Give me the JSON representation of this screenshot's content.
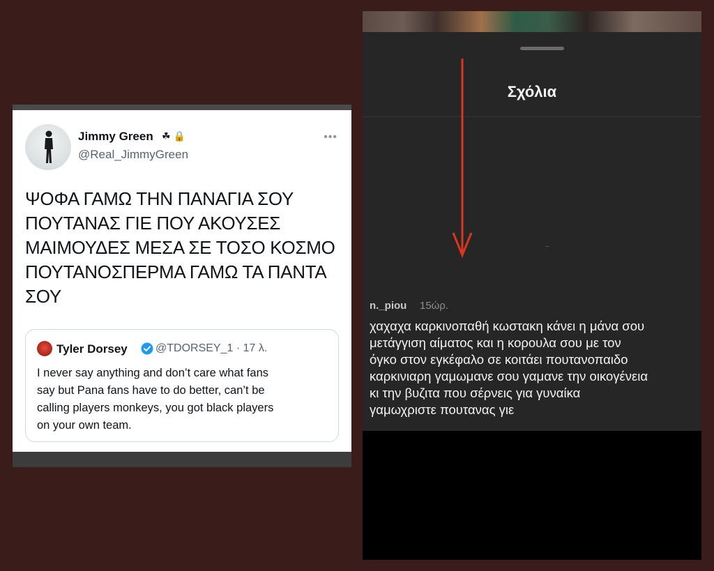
{
  "tweet": {
    "author_name": "Jimmy Green",
    "author_badges": "☘ 🔒",
    "author_handle": "@Real_JimmyGreen",
    "text_lines": [
      "ΨΟΦΑ ΓΑΜΩ ΤΗΝ ΠΑΝΑΓΙΑ ΣΟΥ",
      "ΠΟΥΤΑΝΑΣ ΓΙΕ ΠΟΥ ΑΚΟΥΣΕΣ",
      "ΜΑΙΜΟΥΔΕΣ ΜΕΣΑ ΣΕ ΤΟΣΟ ΚΟΣΜΟ",
      "ΠΟΥΤΑΝΟΣΠΕΡΜΑ ΓΑΜΩ ΤΑ ΠΑΝΤΑ",
      "ΣΟΥ"
    ],
    "quote": {
      "name": "Tyler Dorsey",
      "handle_time": "@TDORSEY_1 · 17 λ.",
      "text_lines": [
        "I never say anything and don’t care what fans",
        "say but Pana fans have to do better, can’t be",
        "calling  players monkeys, you got black players",
        "on your own team."
      ]
    }
  },
  "comments_sheet": {
    "title": "Σχόλια",
    "comment": {
      "username": "n._piou",
      "time": "15ώρ.",
      "text_lines": [
        "χαχαχα καρκινοπαθή κωστακη κάνει η μάνα σου",
        "μετάγγιση αίματος και  η κορουλα σου  με τον",
        "όγκο στον εγκέφαλο σε κοιτάει πουτανοπαιδο",
        "καρκινιαρη γαμωμανε σου γαμανε την οικογένεια",
        "κι την βυζιτα που σέρνεις για γυναίκα",
        "γαμωχριστε πουτανας γιε"
      ]
    }
  },
  "colors": {
    "background": "#3a1c1a",
    "arrow": "#d9361f",
    "sheet": "#262626"
  }
}
